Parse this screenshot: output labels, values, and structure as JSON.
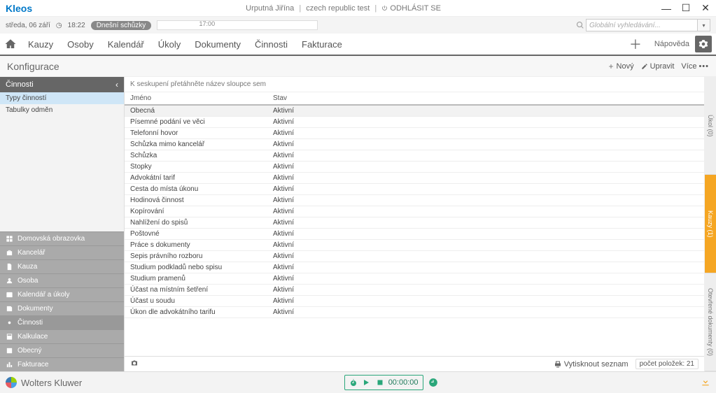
{
  "app": {
    "name": "Kleos"
  },
  "titlebar": {
    "user": "Urputná Jiřína",
    "tenant": "czech republic test",
    "logout": "ODHLÁSIT SE"
  },
  "infobar": {
    "date": "středa, 06 září",
    "clock": "18:22",
    "badge": "Dnešní schůzky",
    "timeline_marker": "17:00",
    "search_placeholder": "Globální vyhledávání..."
  },
  "nav": {
    "items": [
      "Kauzy",
      "Osoby",
      "Kalendář",
      "Úkoly",
      "Dokumenty",
      "Činnosti",
      "Fakturace"
    ],
    "help": "Nápověda"
  },
  "page": {
    "title": "Konfigurace",
    "nov": "Nový",
    "upravit": "Upravit",
    "vice": "Více"
  },
  "sidebar": {
    "header": "Činnosti",
    "items": [
      "Typy činností",
      "Tabulky odměn"
    ],
    "nav": [
      {
        "icon": "grid",
        "label": "Domovská obrazovka"
      },
      {
        "icon": "briefcase",
        "label": "Kancelář"
      },
      {
        "icon": "file",
        "label": "Kauza"
      },
      {
        "icon": "user",
        "label": "Osoba"
      },
      {
        "icon": "calendar",
        "label": "Kalendář a úkoly"
      },
      {
        "icon": "doc",
        "label": "Dokumenty"
      },
      {
        "icon": "gear",
        "label": "Činnosti"
      },
      {
        "icon": "calc",
        "label": "Kalkulace"
      },
      {
        "icon": "square",
        "label": "Obecný"
      },
      {
        "icon": "chart",
        "label": "Fakturace"
      }
    ]
  },
  "table": {
    "group_hint": "K seskupení přetáhněte název sloupce sem",
    "cols": {
      "name": "Jméno",
      "stav": "Stav"
    },
    "rows": [
      {
        "name": "Obecná",
        "stav": "Aktivní"
      },
      {
        "name": "Písemné podání ve věci",
        "stav": "Aktivní"
      },
      {
        "name": "Telefonní hovor",
        "stav": "Aktivní"
      },
      {
        "name": "Schůzka mimo kancelář",
        "stav": "Aktivní"
      },
      {
        "name": "Schůzka",
        "stav": "Aktivní"
      },
      {
        "name": "Stopky",
        "stav": "Aktivní"
      },
      {
        "name": "Advokátní tarif",
        "stav": "Aktivní"
      },
      {
        "name": "Cesta do místa úkonu",
        "stav": "Aktivní"
      },
      {
        "name": "Hodinová činnost",
        "stav": "Aktivní"
      },
      {
        "name": "Kopírování",
        "stav": "Aktivní"
      },
      {
        "name": "Nahlížení do spisů",
        "stav": "Aktivní"
      },
      {
        "name": "Poštovné",
        "stav": "Aktivní"
      },
      {
        "name": "Práce s dokumenty",
        "stav": "Aktivní"
      },
      {
        "name": "Sepis právního rozboru",
        "stav": "Aktivní"
      },
      {
        "name": "Studium podkladů nebo spisu",
        "stav": "Aktivní"
      },
      {
        "name": "Studium pramenů",
        "stav": "Aktivní"
      },
      {
        "name": "Účast na místním šetření",
        "stav": "Aktivní"
      },
      {
        "name": "Účast u soudu",
        "stav": "Aktivní"
      },
      {
        "name": "Úkon dle advokátního tarifu",
        "stav": "Aktivní"
      }
    ],
    "footer": {
      "print": "Vytisknout seznam",
      "count": "počet položek: 21"
    }
  },
  "rightstrips": [
    "Úkol (0)",
    "Kauzy (1)",
    "Otevřené dokumenty (0)"
  ],
  "footer": {
    "company": "Wolters Kluwer",
    "time": "00:00:00"
  }
}
